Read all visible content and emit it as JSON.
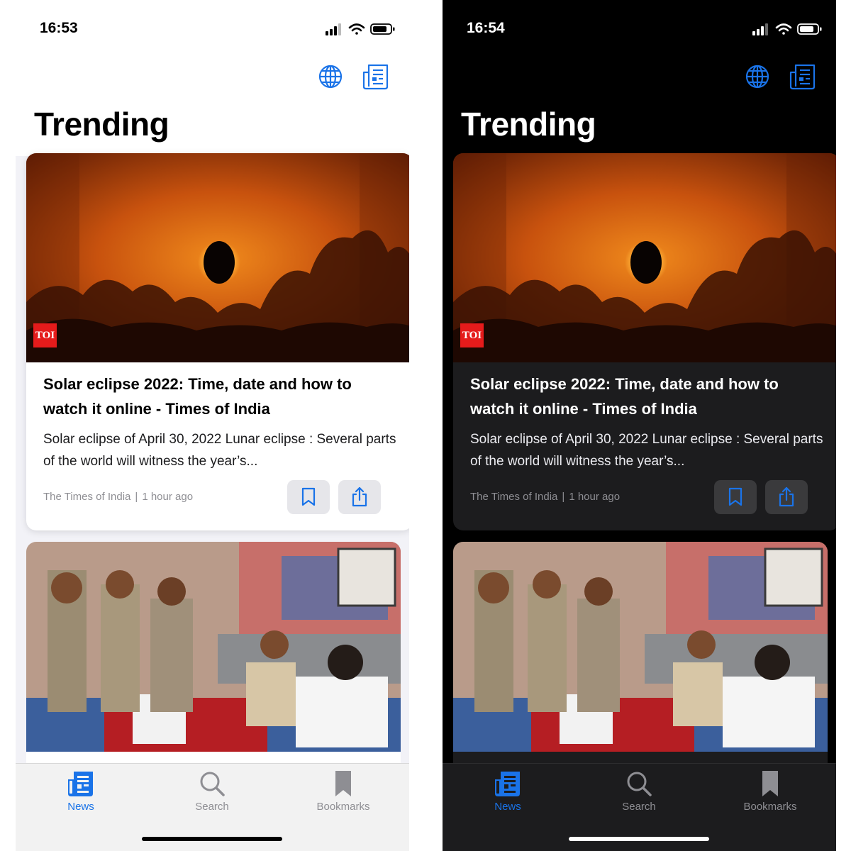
{
  "screens": [
    {
      "theme": "light",
      "status_time": "16:53",
      "heading": "Trending",
      "article": {
        "source_badge": "TOI",
        "title": "Solar eclipse 2022: Time, date and how to watch it online - Times of India",
        "description": "Solar eclipse of April 30, 2022 Lunar eclipse : Several parts of the world will witness the year’s...",
        "source": "The Times of India",
        "separator": "|",
        "time_ago": "1 hour ago"
      },
      "tabs": [
        {
          "label": "News",
          "icon": "newspaper-icon",
          "active": true
        },
        {
          "label": "Search",
          "icon": "magnifier-icon",
          "active": false
        },
        {
          "label": "Bookmarks",
          "icon": "bookmark-icon",
          "active": false
        }
      ]
    },
    {
      "theme": "dark",
      "status_time": "16:54",
      "heading": "Trending",
      "article": {
        "source_badge": "TOI",
        "title": "Solar eclipse 2022: Time, date and how to watch it online - Times of India",
        "description": "Solar eclipse of April 30, 2022 Lunar eclipse : Several parts of the world will witness the year’s...",
        "source": "The Times of India",
        "separator": "|",
        "time_ago": "1 hour ago"
      },
      "tabs": [
        {
          "label": "News",
          "icon": "newspaper-icon",
          "active": true
        },
        {
          "label": "Search",
          "icon": "magnifier-icon",
          "active": false
        },
        {
          "label": "Bookmarks",
          "icon": "bookmark-icon",
          "active": false
        }
      ]
    }
  ],
  "colors": {
    "accent": "#1a73e8",
    "inactive": "#8e8e93",
    "toi_red": "#e51b1b"
  }
}
